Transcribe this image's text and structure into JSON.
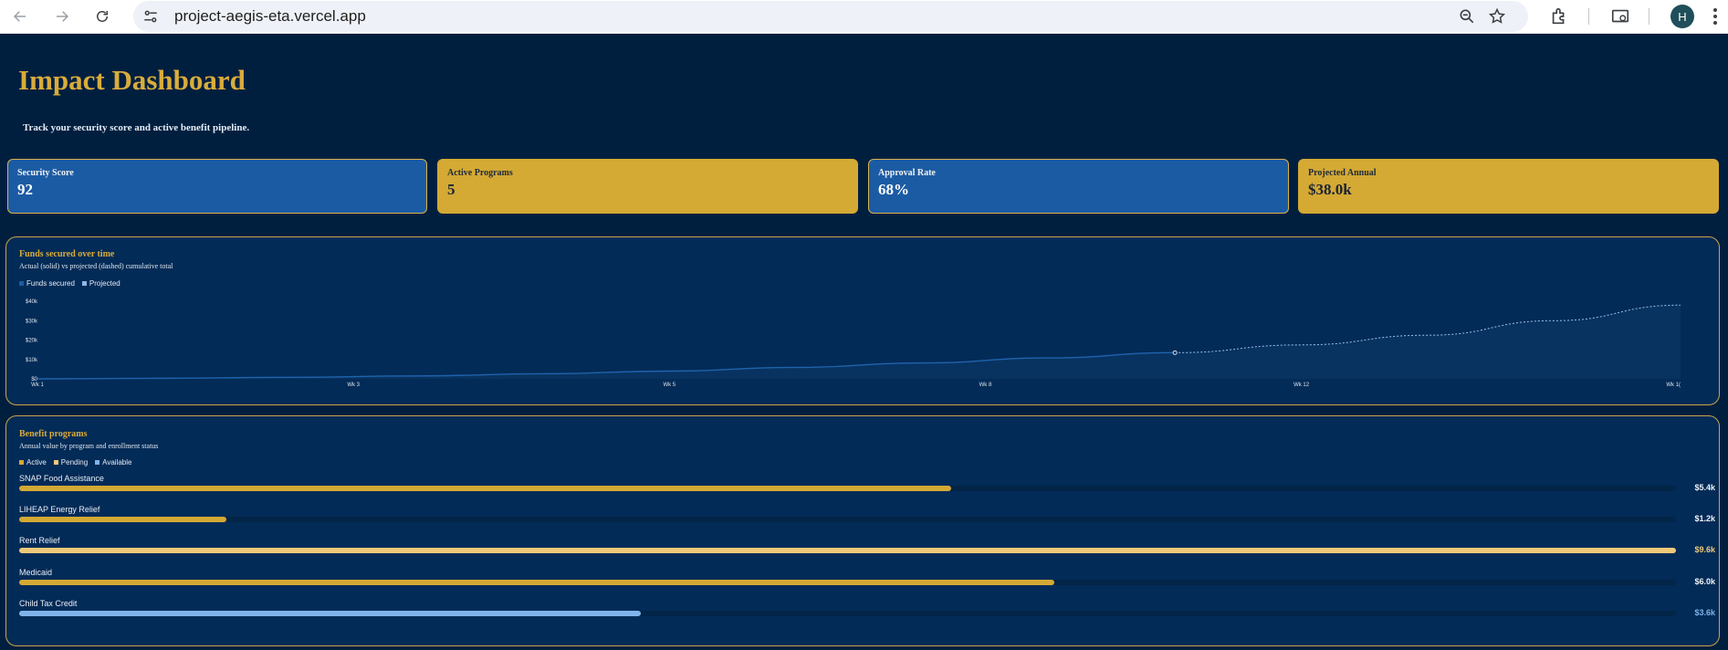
{
  "browser": {
    "url": "project-aegis-eta.vercel.app",
    "avatar_letter": "H",
    "icons": [
      "back-arrow-icon",
      "forward-arrow-icon",
      "reload-icon",
      "site-info-icon",
      "zoom-icon",
      "bookmark-star-icon",
      "extensions-icon",
      "screen-search-icon",
      "menu-kebab-icon"
    ]
  },
  "header": {
    "title": "Impact Dashboard",
    "subtitle": "Track your security score and active benefit pipeline."
  },
  "stats": [
    {
      "label": "Security Score",
      "value": "92",
      "color": "#1b5ba4"
    },
    {
      "label": "Active Programs",
      "value": "5",
      "color": "#d4a934"
    },
    {
      "label": "Approval Rate",
      "value": "68%",
      "color": "#1b5ba4"
    },
    {
      "label": "Projected Annual",
      "value": "$38.0k",
      "color": "#d4a934"
    }
  ],
  "funds_panel": {
    "title": "Funds secured over time",
    "subtitle": "Actual (solid) vs projected (dashed) cumulative total",
    "legend": [
      {
        "label": "Funds secured",
        "color": "#1b5ba4"
      },
      {
        "label": "Projected",
        "color": "#8fb8e6"
      }
    ]
  },
  "chart_data": {
    "type": "line",
    "title": "Funds secured over time",
    "subtitle": "Actual (solid) vs projected (dashed) cumulative total",
    "x": [
      1,
      2,
      3,
      4,
      5,
      6,
      7,
      8,
      9,
      10,
      11,
      12,
      13,
      14
    ],
    "x_tick_labels": [
      "Wk 1",
      "Wk 3",
      "Wk 5",
      "Wk 8",
      "Wk 12",
      "Wk 1("
    ],
    "y_tick_labels": [
      "$0",
      "$10k",
      "$20k",
      "$30k",
      "$40k"
    ],
    "ylim": [
      0,
      40000
    ],
    "series": [
      {
        "name": "Funds secured",
        "style": "solid",
        "x": [
          1,
          2,
          3,
          4,
          5,
          6,
          7,
          8,
          9,
          10
        ],
        "values": [
          0,
          300,
          800,
          1500,
          2600,
          4000,
          5900,
          8200,
          10800,
          13500
        ]
      },
      {
        "name": "Projected",
        "style": "dashed",
        "x": [
          10,
          11,
          12,
          13,
          14
        ],
        "values": [
          13500,
          17500,
          22500,
          30000,
          38000
        ]
      }
    ],
    "grid": false,
    "legend": "top-left"
  },
  "programs_panel": {
    "title": "Benefit programs",
    "subtitle": "Annual value by program and enrollment status",
    "legend": [
      {
        "label": "Active",
        "color": "#d4a934"
      },
      {
        "label": "Pending",
        "color": "#f0c979"
      },
      {
        "label": "Available",
        "color": "#7fb3ea"
      }
    ],
    "items": [
      {
        "name": "SNAP Food Assistance",
        "value": "$5.4k",
        "fraction": 0.5625,
        "status": "Active",
        "color": "#d4a934",
        "value_color": "#f0f3f7"
      },
      {
        "name": "LIHEAP Energy Relief",
        "value": "$1.2k",
        "fraction": 0.125,
        "status": "Active",
        "color": "#d4a934",
        "value_color": "#f0f3f7"
      },
      {
        "name": "Rent Relief",
        "value": "$9.6k",
        "fraction": 1.0,
        "status": "Pending",
        "color": "#f0c979",
        "value_color": "#f0c979"
      },
      {
        "name": "Medicaid",
        "value": "$6.0k",
        "fraction": 0.625,
        "status": "Active",
        "color": "#d4a934",
        "value_color": "#f0f3f7"
      },
      {
        "name": "Child Tax Credit",
        "value": "$3.6k",
        "fraction": 0.375,
        "status": "Available",
        "color": "#7fb3ea",
        "value_color": "#7fb3ea"
      }
    ]
  }
}
